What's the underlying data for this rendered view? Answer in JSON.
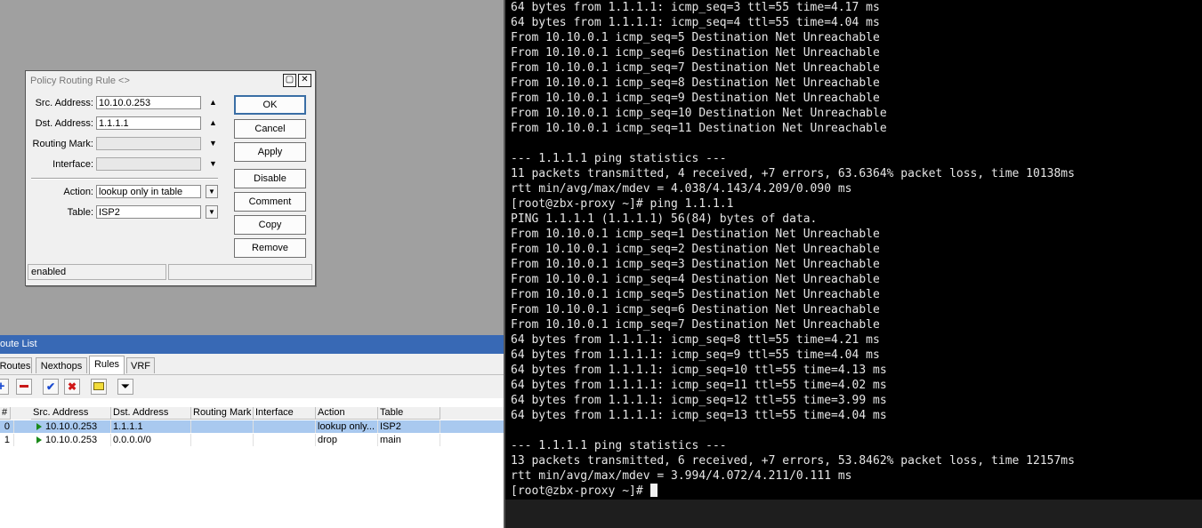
{
  "dialog": {
    "title": "Policy Routing Rule <>",
    "fields": {
      "src_address": {
        "label": "Src. Address:",
        "value": "10.10.0.253"
      },
      "dst_address": {
        "label": "Dst. Address:",
        "value": "1.1.1.1"
      },
      "routing_mark": {
        "label": "Routing Mark:",
        "value": ""
      },
      "interface": {
        "label": "Interface:",
        "value": ""
      },
      "action": {
        "label": "Action:",
        "value": "lookup only in table"
      },
      "table": {
        "label": "Table:",
        "value": "ISP2"
      }
    },
    "buttons": {
      "ok": "OK",
      "cancel": "Cancel",
      "apply": "Apply",
      "disable": "Disable",
      "comment": "Comment",
      "copy": "Copy",
      "remove": "Remove"
    },
    "status": "enabled"
  },
  "route_list": {
    "title": "oute List",
    "tabs": [
      "Routes",
      "Nexthops",
      "Rules",
      "VRF"
    ],
    "active_tab": "Rules",
    "columns": [
      "#",
      "Src. Address",
      "Dst. Address",
      "Routing Mark",
      "Interface",
      "Action",
      "Table"
    ],
    "rows": [
      {
        "num": "0",
        "src": "10.10.0.253",
        "dst": "1.1.1.1",
        "mark": "",
        "iface": "",
        "action": "lookup only...",
        "table": "ISP2",
        "selected": true
      },
      {
        "num": "1",
        "src": "10.10.0.253",
        "dst": "0.0.0.0/0",
        "mark": "",
        "iface": "",
        "action": "drop",
        "table": "main",
        "selected": false
      }
    ]
  },
  "terminal": {
    "lines": [
      "64 bytes from 1.1.1.1: icmp_seq=3 ttl=55 time=4.17 ms",
      "64 bytes from 1.1.1.1: icmp_seq=4 ttl=55 time=4.04 ms",
      "From 10.10.0.1 icmp_seq=5 Destination Net Unreachable",
      "From 10.10.0.1 icmp_seq=6 Destination Net Unreachable",
      "From 10.10.0.1 icmp_seq=7 Destination Net Unreachable",
      "From 10.10.0.1 icmp_seq=8 Destination Net Unreachable",
      "From 10.10.0.1 icmp_seq=9 Destination Net Unreachable",
      "From 10.10.0.1 icmp_seq=10 Destination Net Unreachable",
      "From 10.10.0.1 icmp_seq=11 Destination Net Unreachable",
      "",
      "--- 1.1.1.1 ping statistics ---",
      "11 packets transmitted, 4 received, +7 errors, 63.6364% packet loss, time 10138ms",
      "rtt min/avg/max/mdev = 4.038/4.143/4.209/0.090 ms",
      "[root@zbx-proxy ~]# ping 1.1.1.1",
      "PING 1.1.1.1 (1.1.1.1) 56(84) bytes of data.",
      "From 10.10.0.1 icmp_seq=1 Destination Net Unreachable",
      "From 10.10.0.1 icmp_seq=2 Destination Net Unreachable",
      "From 10.10.0.1 icmp_seq=3 Destination Net Unreachable",
      "From 10.10.0.1 icmp_seq=4 Destination Net Unreachable",
      "From 10.10.0.1 icmp_seq=5 Destination Net Unreachable",
      "From 10.10.0.1 icmp_seq=6 Destination Net Unreachable",
      "From 10.10.0.1 icmp_seq=7 Destination Net Unreachable",
      "64 bytes from 1.1.1.1: icmp_seq=8 ttl=55 time=4.21 ms",
      "64 bytes from 1.1.1.1: icmp_seq=9 ttl=55 time=4.04 ms",
      "64 bytes from 1.1.1.1: icmp_seq=10 ttl=55 time=4.13 ms",
      "64 bytes from 1.1.1.1: icmp_seq=11 ttl=55 time=4.02 ms",
      "64 bytes from 1.1.1.1: icmp_seq=12 ttl=55 time=3.99 ms",
      "64 bytes from 1.1.1.1: icmp_seq=13 ttl=55 time=4.04 ms",
      "",
      "--- 1.1.1.1 ping statistics ---",
      "13 packets transmitted, 6 received, +7 errors, 53.8462% packet loss, time 12157ms",
      "rtt min/avg/max/mdev = 3.994/4.072/4.211/0.111 ms"
    ],
    "prompt": "[root@zbx-proxy ~]# "
  },
  "colors": {
    "selected_row": "#a9c9ef",
    "route_list_title": "#3869b5",
    "terminal_bg": "#000000"
  }
}
